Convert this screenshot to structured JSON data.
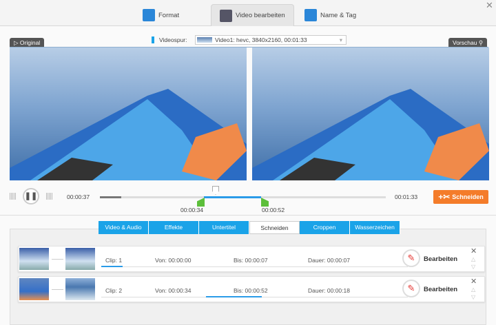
{
  "top_tabs": [
    {
      "label": "Format"
    },
    {
      "label": "Video bearbeiten"
    },
    {
      "label": "Name & Tag"
    }
  ],
  "close": "✕",
  "original_label": "Original",
  "preview_label": "Vorschau",
  "videospur_label": "Videospur:",
  "video_track": "Video1: hevc, 3840x2160, 00:01:33",
  "player": {
    "current": "00:00:37",
    "total": "00:01:33",
    "sel_start": "00:00:34",
    "sel_end": "00:00:52",
    "progress_fraction": 0.398
  },
  "cut_button": "Schneiden",
  "edit_tabs": [
    "Video & Audio",
    "Effekte",
    "Untertitel",
    "Schneiden",
    "Croppen",
    "Wasserzeichen"
  ],
  "clips": [
    {
      "clip": "Clip: 1",
      "von": "Von:  00:00:00",
      "bis": "Bis:  00:00:07",
      "dauer": "Dauer: 00:00:07"
    },
    {
      "clip": "Clip: 2",
      "von": "Von:  00:00:34",
      "bis": "Bis:  00:00:52",
      "dauer": "Dauer: 00:00:18"
    }
  ],
  "edit_label": "Bearbeiten",
  "colors": {
    "accent": "#1aa3e8",
    "orange": "#f47c2a",
    "green": "#5cbf3a"
  }
}
